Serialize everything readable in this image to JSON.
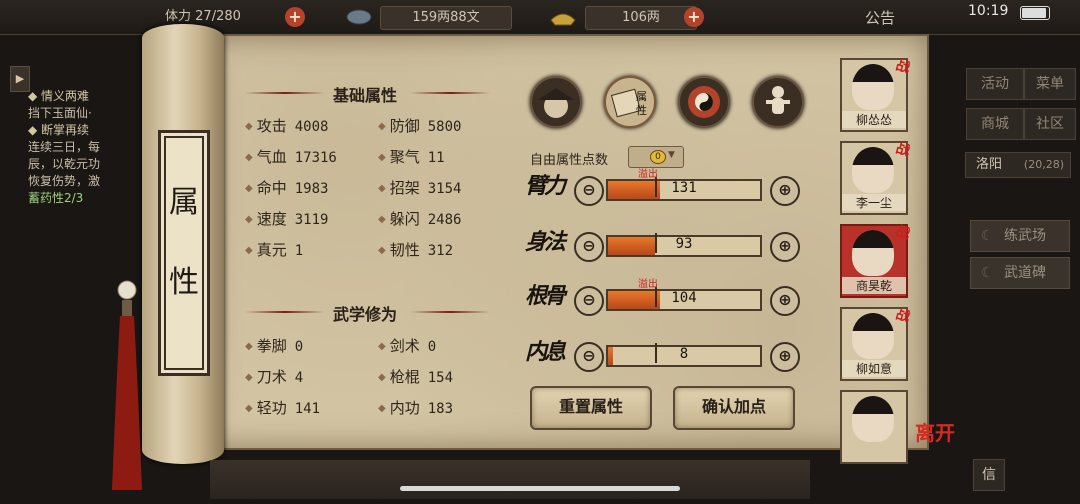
{
  "topbar": {
    "stamina_label": "体力",
    "stamina": "27/280",
    "money": "159两88文",
    "gold": "106两",
    "notice": "公告",
    "time": "10:19"
  },
  "quest": {
    "items": [
      {
        "head": "◆ 情义两难",
        "lines": [
          "挡下玉面仙·"
        ]
      },
      {
        "head": "◆ 断掌再续",
        "lines": [
          "连续三日，每",
          "辰，以乾元功",
          "恢复伤势，激",
          "蓄药性2/3"
        ]
      }
    ]
  },
  "scroll_tag": [
    "属",
    "性"
  ],
  "basic": {
    "title": "基础属性",
    "stats": [
      {
        "label": "攻击",
        "value": "4008"
      },
      {
        "label": "防御",
        "value": "5800"
      },
      {
        "label": "气血",
        "value": "17316"
      },
      {
        "label": "聚气",
        "value": "11"
      },
      {
        "label": "命中",
        "value": "1983"
      },
      {
        "label": "招架",
        "value": "3154"
      },
      {
        "label": "速度",
        "value": "3119"
      },
      {
        "label": "躲闪",
        "value": "2486"
      },
      {
        "label": "真元",
        "value": "1"
      },
      {
        "label": "韧性",
        "value": "312"
      }
    ]
  },
  "martial": {
    "title": "武学修为",
    "stats": [
      {
        "label": "拳脚",
        "value": "0"
      },
      {
        "label": "剑术",
        "value": "0"
      },
      {
        "label": "刀术",
        "value": "4"
      },
      {
        "label": "枪棍",
        "value": "154"
      },
      {
        "label": "轻功",
        "value": "141"
      },
      {
        "label": "内功",
        "value": "183"
      }
    ]
  },
  "tabs": [
    {
      "name": "portrait-tab-icon"
    },
    {
      "name": "attribute-tab-icon",
      "label": "属\n性"
    },
    {
      "name": "bagua-tab-icon"
    },
    {
      "name": "meridian-tab-icon"
    }
  ],
  "free_points": {
    "label": "自由属性点数",
    "value": "0"
  },
  "attributes": [
    {
      "name": "臂力",
      "value": "131",
      "fill": 0.34,
      "overflow": "溢出"
    },
    {
      "name": "身法",
      "value": "93",
      "fill": 0.31,
      "overflow": ""
    },
    {
      "name": "根骨",
      "value": "104",
      "fill": 0.34,
      "overflow": "溢出"
    },
    {
      "name": "内息",
      "value": "8",
      "fill": 0.03,
      "overflow": ""
    }
  ],
  "buttons": {
    "reset": "重置属性",
    "confirm": "确认加点",
    "minus": "⊖",
    "plus": "⊕"
  },
  "characters": [
    {
      "name": "柳怂怂",
      "tag": "战"
    },
    {
      "name": "李一尘",
      "tag": "战"
    },
    {
      "name": "商昊乾",
      "tag": "战"
    },
    {
      "name": "柳如意",
      "tag": "战"
    },
    {
      "name": "",
      "tag": ""
    }
  ],
  "right_menu": {
    "activity": "活动",
    "menu": "菜单",
    "shop": "商城",
    "community": "社区",
    "location": "洛阳",
    "coords": "(20,28)",
    "links": [
      "练武场",
      "武道碑"
    ],
    "leave": "离开",
    "chat": "信"
  }
}
